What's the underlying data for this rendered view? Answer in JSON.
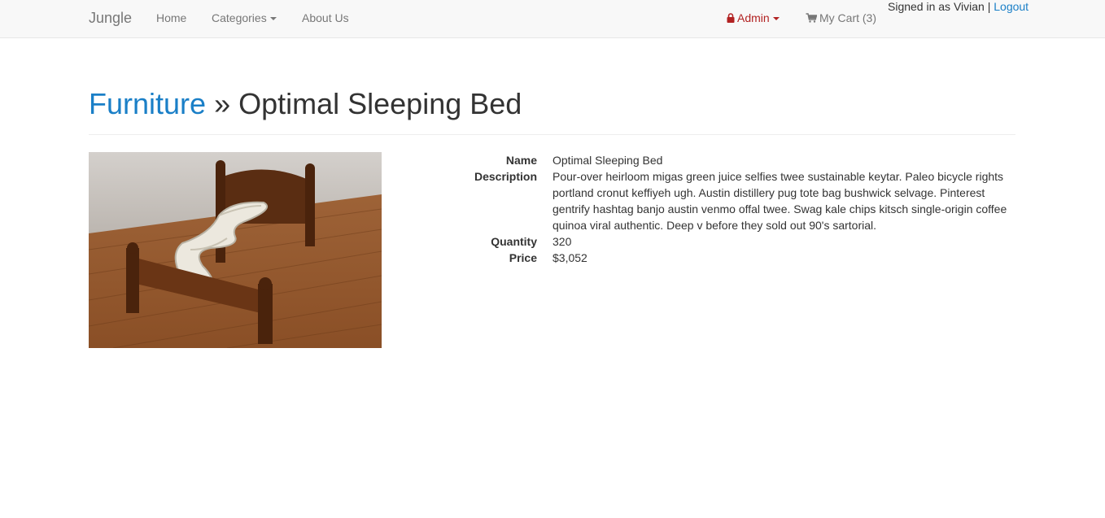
{
  "navbar": {
    "brand": "Jungle",
    "home": "Home",
    "categories": "Categories",
    "about": "About Us",
    "admin": "Admin",
    "cart": "My Cart (3)",
    "signed_in_text": "Signed in as Vivian |",
    "logout": "Logout"
  },
  "header": {
    "category": "Furniture",
    "separator": " » ",
    "product_name": "Optimal Sleeping Bed"
  },
  "details": {
    "labels": {
      "name": "Name",
      "description": "Description",
      "quantity": "Quantity",
      "price": "Price"
    },
    "name": "Optimal Sleeping Bed",
    "description": "Pour-over heirloom migas green juice selfies twee sustainable keytar. Paleo bicycle rights portland cronut keffiyeh ugh. Austin distillery pug tote bag bushwick selvage. Pinterest gentrify hashtag banjo austin venmo offal twee. Swag kale chips kitsch single-origin coffee quinoa viral authentic. Deep v before they sold out 90's sartorial.",
    "quantity": "320",
    "price": "$3,052"
  },
  "colors": {
    "link": "#1a7fc7",
    "admin": "#b22222",
    "navbar_bg": "#f8f8f8"
  },
  "icons": {
    "admin": "lock-icon",
    "cart": "shopping-cart-icon"
  }
}
